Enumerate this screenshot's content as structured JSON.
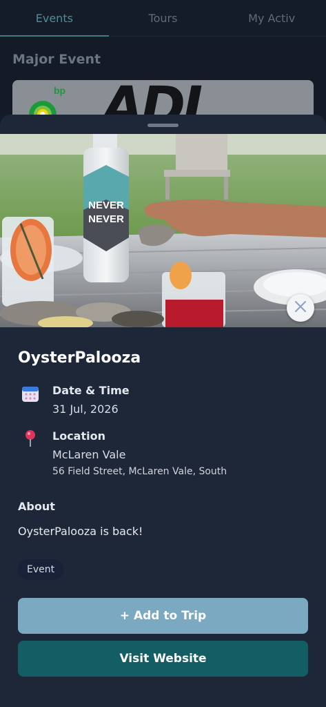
{
  "tabs": [
    {
      "label": "Events"
    },
    {
      "label": "Tours"
    },
    {
      "label": "My Activ"
    }
  ],
  "background": {
    "section_title": "Major Event",
    "banner_text": "ADL"
  },
  "event": {
    "title": "OysterPalooza",
    "bottle_label_line1": "NEVER",
    "bottle_label_line2": "NEVER",
    "date_label": "Date & Time",
    "date_value": "31 Jul, 2026",
    "location_label": "Location",
    "location_name": "McLaren Vale",
    "location_address": "56 Field Street, McLaren Vale, South",
    "about_label": "About",
    "about_text": "OysterPalooza is back!",
    "category_badge": "Event"
  },
  "actions": {
    "add_to_trip": "+ Add to Trip",
    "visit_website": "Visit Website"
  },
  "colors": {
    "sheet_bg": "#1d2738",
    "add_button": "#7aa9c1",
    "visit_button": "#135d65",
    "active_tab": "#4d8e98"
  },
  "icons": [
    "calendar-icon",
    "location-pin-icon",
    "close-icon"
  ]
}
